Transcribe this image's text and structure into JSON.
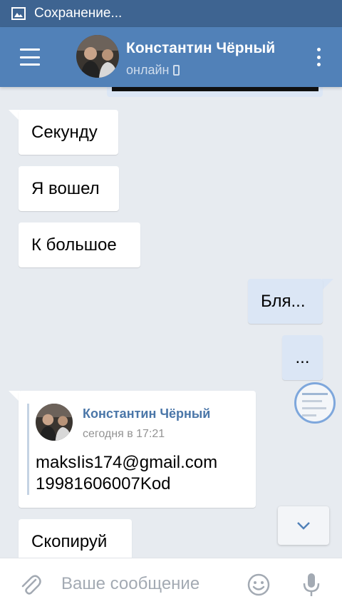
{
  "status_bar": {
    "icon": "image-icon",
    "text": "Сохранение..."
  },
  "header": {
    "name": "Константин Чёрный",
    "status": "онлайн",
    "status_icon": "phone-icon",
    "colors": {
      "bar": "#5181b8",
      "status_bar": "#3e6491"
    }
  },
  "messages": [
    {
      "direction": "in",
      "text": "Секунду"
    },
    {
      "direction": "in",
      "text": "Я вошел"
    },
    {
      "direction": "in",
      "text": "К большое"
    },
    {
      "direction": "out",
      "text": "Бля..."
    },
    {
      "direction": "out",
      "text": "..."
    }
  ],
  "forwarded": {
    "author": "Константин Чёрный",
    "time": "сегодня в 17:21",
    "line1": "maksIis174@gmail.com",
    "line2": "19981606007Kod"
  },
  "last_message": {
    "direction": "in",
    "text": "Скопируй"
  },
  "composer": {
    "placeholder": "Ваше сообщение"
  }
}
